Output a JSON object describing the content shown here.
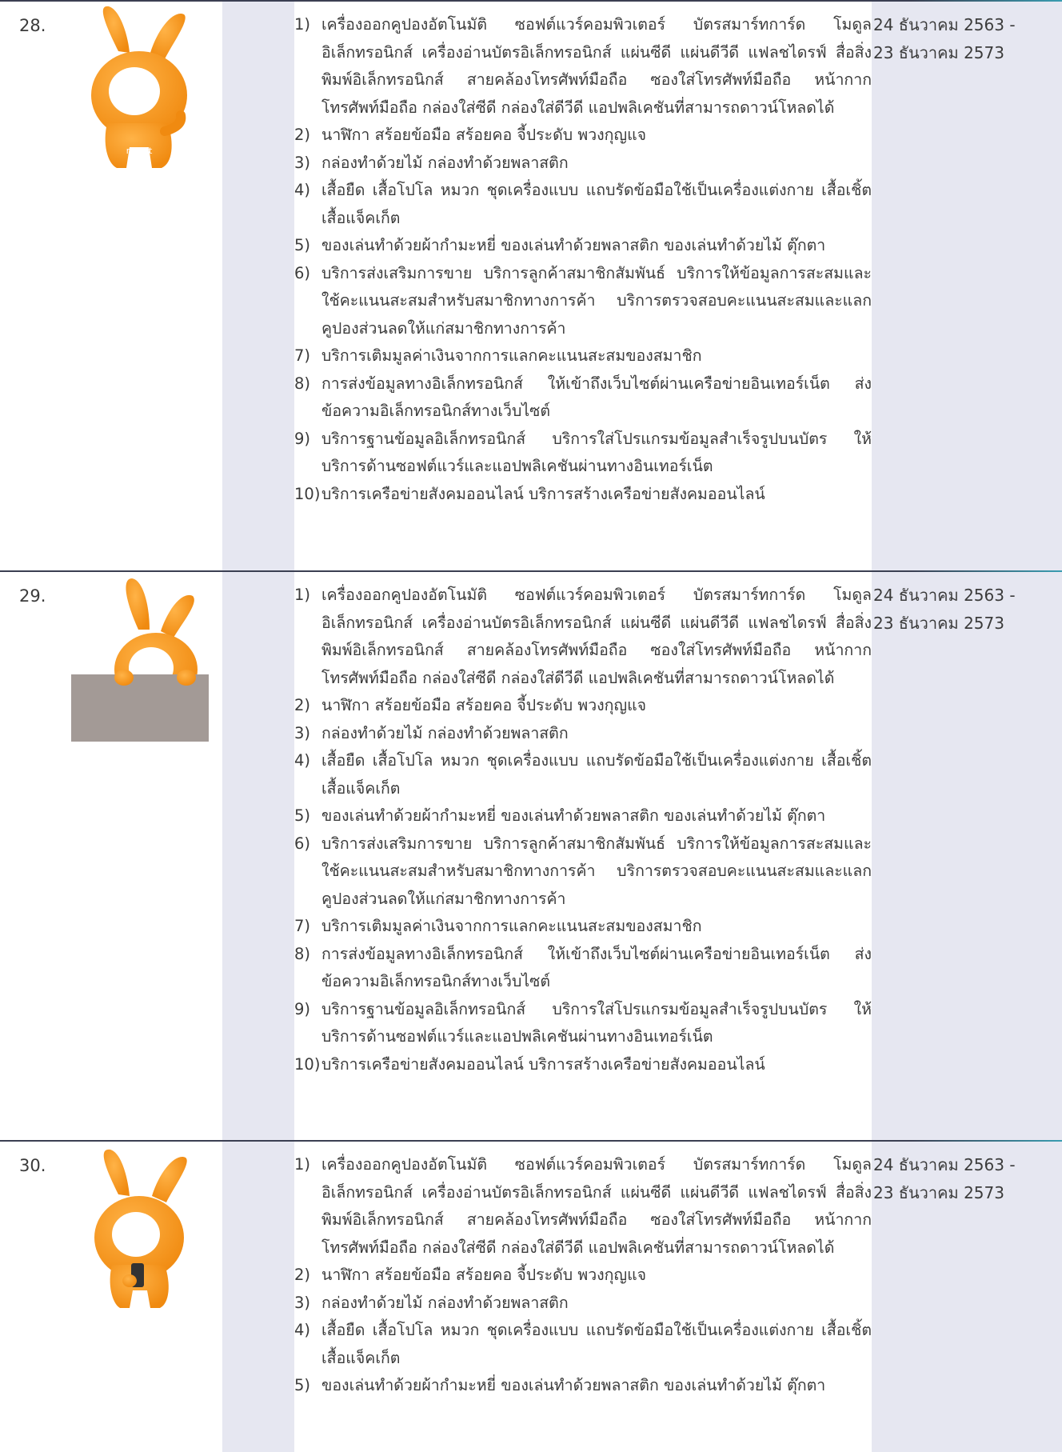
{
  "items": [
    "เครื่องออกคูปองอัตโนมัติ ซอฟต์แวร์คอมพิวเตอร์ บัตรสมาร์ทการ์ด โมดูลอิเล็กทรอนิกส์ เครื่องอ่านบัตรอิเล็กทรอนิกส์ แผ่นซีดี แผ่นดีวีดี แฟลชไดรฟ์ สื่อสิ่งพิมพ์อิเล็กทรอนิกส์ สายคล้องโทรศัพท์มือถือ ซองใส่โทรศัพท์มือถือ หน้ากากโทรศัพท์มือถือ กล่องใส่ซีดี กล่องใส่ดีวีดี แอปพลิเคชันที่สามารถดาวน์โหลดได้",
    "นาฬิกา สร้อยข้อมือ สร้อยคอ จี้ประดับ พวงกุญแจ",
    "กล่องทำด้วยไม้ กล่องทำด้วยพลาสติก",
    "เสื้อยืด เสื้อโปโล หมวก ชุดเครื่องแบบ แถบรัดข้อมือใช้เป็นเครื่องแต่งกาย เสื้อเชิ้ต เสื้อแจ็คเก็ต",
    "ของเล่นทำด้วยผ้ากำมะหยี่ ของเล่นทำด้วยพลาสติก ของเล่นทำด้วยไม้ ตุ๊กตา",
    "บริการส่งเสริมการขาย บริการลูกค้าสมาชิกสัมพันธ์ บริการให้ข้อมูลการสะสมและใช้คะแนนสะสมสำหรับสมาชิกทางการค้า บริการตรวจสอบคะแนนสะสมและแลกคูปองส่วนลดให้แก่สมาชิกทางการค้า",
    "บริการเติมมูลค่าเงินจากการแลกคะแนนสะสมของสมาชิก",
    "การส่งข้อมูลทางอิเล็กทรอนิกส์ ให้เข้าถึงเว็บไซต์ผ่านเครือข่ายอินเทอร์เน็ต ส่งข้อความอิเล็กทรอนิกส์ทางเว็บไซต์",
    "บริการฐานข้อมูลอิเล็กทรอนิกส์ บริการใส่โปรแกรมข้อมูลสำเร็จรูปบนบัตร ให้บริการด้านซอฟต์แวร์และแอปพลิเคชันผ่านทางอินเทอร์เน็ต",
    "บริการเครือข่ายสังคมออนไลน์ บริการสร้างเครือข่ายสังคมออนไลน์"
  ],
  "rows": [
    {
      "number": "28.",
      "date_start": "24 ธันวาคม 2563 -",
      "date_end": "23 ธันวาคม 2573",
      "mascot": "rabbit-waving-icon"
    },
    {
      "number": "29.",
      "date_start": "24 ธันวาคม 2563 -",
      "date_end": "23 ธันวาคม 2573",
      "mascot": "rabbit-holding-sign-icon"
    },
    {
      "number": "30.",
      "date_start": "24 ธันวาคม 2563 -",
      "date_end": "23 ธันวาคม 2573",
      "mascot": "rabbit-holding-phone-icon"
    }
  ],
  "item_numbers": [
    "1)",
    "2)",
    "3)",
    "4)",
    "5)",
    "6)",
    "7)",
    "8)",
    "9)",
    "10)"
  ],
  "mascot_badge_text": "rabbit",
  "colors": {
    "mascot_orange": "#f7941d",
    "column_shade": "#e6e7f1",
    "rule_dark": "#3b3f52",
    "rule_teal": "#3a9db1"
  }
}
